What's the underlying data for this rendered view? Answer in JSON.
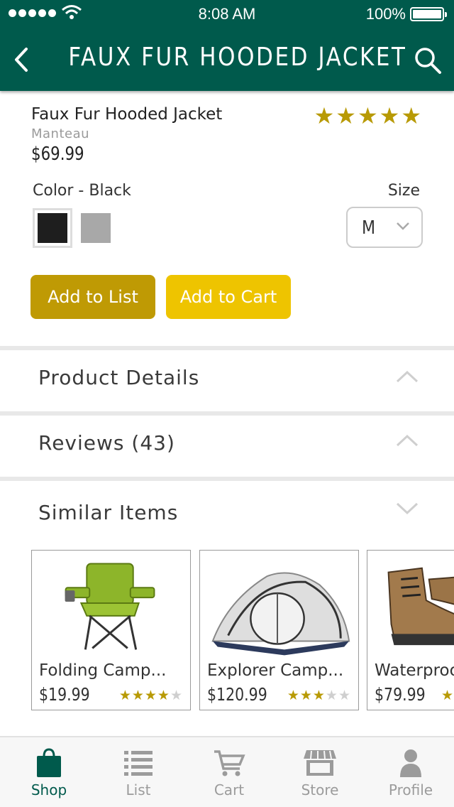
{
  "status_bar": {
    "time": "8:08 AM",
    "battery": "100%"
  },
  "nav": {
    "title": "FAUX FUR HOODED JACKET",
    "back_icon": "back-chevron-icon",
    "search_icon": "search-icon"
  },
  "product": {
    "name": "Faux Fur Hooded Jacket",
    "brand": "Manteau",
    "price": "$69.99",
    "rating_stars": "★★★★★",
    "rating": 5,
    "color_label": "Color - Black",
    "colors": [
      "black",
      "gray"
    ],
    "size_label": "Size",
    "size_value": "M",
    "add_to_list": "Add to List",
    "add_to_cart": "Add to Cart"
  },
  "sections": {
    "details": "Product Details",
    "reviews": "Reviews (43)",
    "similar": "Similar Items"
  },
  "similar_items": [
    {
      "name": "Folding Camp...",
      "price": "$19.99",
      "stars_on": "★★★★",
      "stars_off": "★",
      "rating": 4
    },
    {
      "name": "Explorer Camp...",
      "price": "$120.99",
      "stars_on": "★★★",
      "stars_off": "★★",
      "rating": 3
    },
    {
      "name": "Waterproof",
      "price": "$79.99",
      "stars_on": "★",
      "stars_off": "",
      "rating": 1
    }
  ],
  "tabs": [
    {
      "label": "Shop",
      "icon": "shopping-bag-icon",
      "active": true
    },
    {
      "label": "List",
      "icon": "list-icon",
      "active": false
    },
    {
      "label": "Cart",
      "icon": "cart-icon",
      "active": false
    },
    {
      "label": "Store",
      "icon": "store-icon",
      "active": false
    },
    {
      "label": "Profile",
      "icon": "profile-icon",
      "active": false
    }
  ],
  "colors": {
    "brand": "#005a4c",
    "gold_dark": "#bf9a04",
    "gold": "#eec400",
    "star": "#b89a05"
  }
}
